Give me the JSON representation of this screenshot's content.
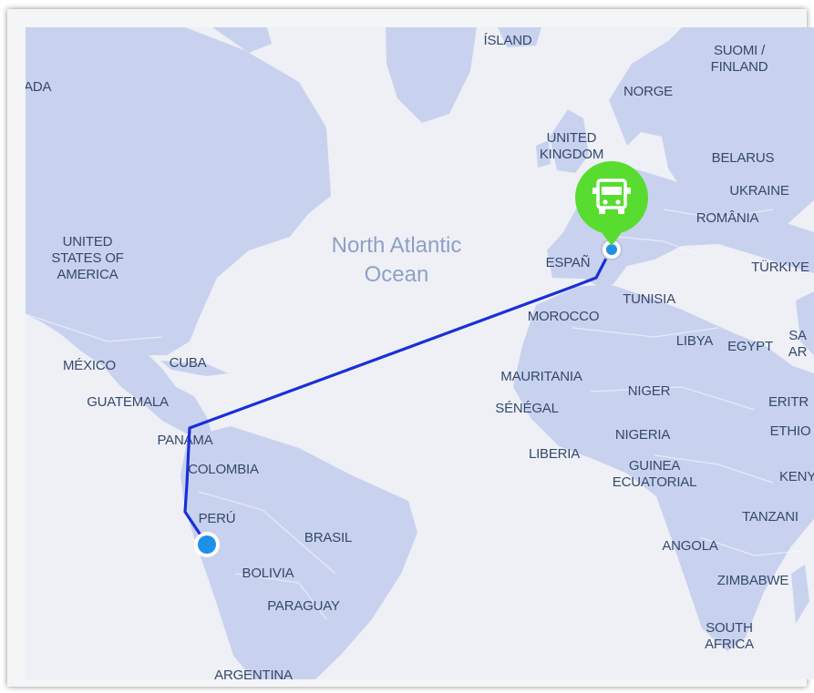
{
  "map": {
    "ocean_label": [
      "North Atlantic",
      "Ocean"
    ],
    "countries": [
      {
        "id": "iceland",
        "lines": [
          "ÍSLAND"
        ]
      },
      {
        "id": "canada",
        "lines": [
          "ANADA"
        ]
      },
      {
        "id": "suomi",
        "lines": [
          "SUOMI /",
          "FINLAND"
        ]
      },
      {
        "id": "norge",
        "lines": [
          "NORGE"
        ]
      },
      {
        "id": "uk",
        "lines": [
          "UNITED",
          "KINGDOM"
        ]
      },
      {
        "id": "belarus",
        "lines": [
          "BELARUS"
        ]
      },
      {
        "id": "ukraine",
        "lines": [
          "UKRAINE"
        ]
      },
      {
        "id": "romania",
        "lines": [
          "ROMÂNIA"
        ]
      },
      {
        "id": "usa",
        "lines": [
          "UNITED",
          "STATES OF",
          "AMERICA"
        ]
      },
      {
        "id": "espana",
        "lines": [
          "ESPAÑ"
        ]
      },
      {
        "id": "turkiye",
        "lines": [
          "TÜRKIYE"
        ]
      },
      {
        "id": "tunisia",
        "lines": [
          "TUNISIA"
        ]
      },
      {
        "id": "morocco",
        "lines": [
          "MOROCCO"
        ]
      },
      {
        "id": "libya",
        "lines": [
          "LIBYA"
        ]
      },
      {
        "id": "egypt",
        "lines": [
          "EGYPT"
        ]
      },
      {
        "id": "saudi",
        "lines": [
          "SA",
          "AR"
        ]
      },
      {
        "id": "mexico",
        "lines": [
          "MÉXICO"
        ]
      },
      {
        "id": "cuba",
        "lines": [
          "CUBA"
        ]
      },
      {
        "id": "mauritania",
        "lines": [
          "MAURITANIA"
        ]
      },
      {
        "id": "niger",
        "lines": [
          "NIGER"
        ]
      },
      {
        "id": "senegal",
        "lines": [
          "SÉNÉGAL"
        ]
      },
      {
        "id": "guatemala",
        "lines": [
          "GUATEMALA"
        ]
      },
      {
        "id": "eritrea",
        "lines": [
          "ERITR"
        ]
      },
      {
        "id": "ethiopia",
        "lines": [
          "ETHIO"
        ]
      },
      {
        "id": "panama",
        "lines": [
          "PANAMA"
        ]
      },
      {
        "id": "nigeria",
        "lines": [
          "NIGERIA"
        ]
      },
      {
        "id": "liberia",
        "lines": [
          "LIBERIA"
        ]
      },
      {
        "id": "colombia",
        "lines": [
          "COLOMBIA"
        ]
      },
      {
        "id": "guinea",
        "lines": [
          "GUINEA",
          "ECUATORIAL"
        ]
      },
      {
        "id": "kenya",
        "lines": [
          "KENY"
        ]
      },
      {
        "id": "peru",
        "lines": [
          "PERÚ"
        ]
      },
      {
        "id": "brasil",
        "lines": [
          "BRASIL"
        ]
      },
      {
        "id": "tanzania",
        "lines": [
          "TANZANI"
        ]
      },
      {
        "id": "angola",
        "lines": [
          "ANGOLA"
        ]
      },
      {
        "id": "bolivia",
        "lines": [
          "BOLIVIA"
        ]
      },
      {
        "id": "zimbabwe",
        "lines": [
          "ZIMBABWE"
        ]
      },
      {
        "id": "paraguay",
        "lines": [
          "PARAGUAY"
        ]
      },
      {
        "id": "south-africa",
        "lines": [
          "SOUTH",
          "AFRICA"
        ]
      },
      {
        "id": "argentina",
        "lines": [
          "ARGENTINA"
        ]
      }
    ],
    "route": {
      "origin": "PERÚ",
      "destination": "ESPAÑ",
      "vehicle_icon": "truck-icon",
      "colors": {
        "route_line": "#1a2fd8",
        "origin_dot": "#1e90e8",
        "vehicle_badge": "#58dc30",
        "land": "#c8d2ee",
        "water": "#eef0f6",
        "label": "#35486b"
      }
    }
  }
}
